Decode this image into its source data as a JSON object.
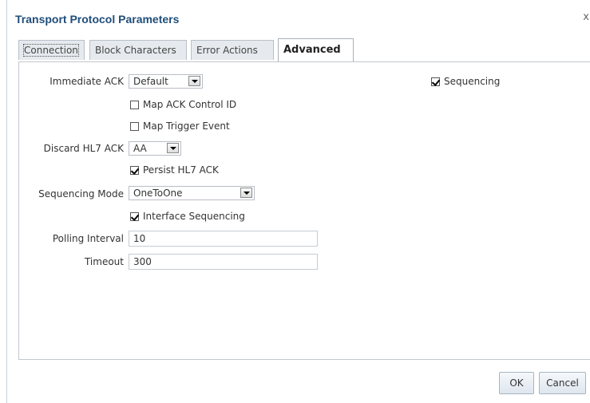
{
  "dialog": {
    "title": "Transport Protocol Parameters",
    "close_symbol": "x"
  },
  "tabs": [
    {
      "label": "Connection"
    },
    {
      "label": "Block Characters"
    },
    {
      "label": "Error Actions"
    },
    {
      "label": "Advanced"
    }
  ],
  "form": {
    "immediate_ack": {
      "label": "Immediate ACK",
      "value": "Default"
    },
    "map_ack_control_id": {
      "label": "Map ACK Control ID",
      "checked": false
    },
    "map_trigger_event": {
      "label": "Map Trigger Event",
      "checked": false
    },
    "discard_hl7_ack": {
      "label": "Discard HL7 ACK",
      "value": "AA"
    },
    "persist_hl7_ack": {
      "label": "Persist HL7 ACK",
      "checked": true
    },
    "sequencing_mode": {
      "label": "Sequencing Mode",
      "value": "OneToOne"
    },
    "interface_sequencing": {
      "label": "Interface Sequencing",
      "checked": true
    },
    "polling_interval": {
      "label": "Polling Interval",
      "value": "10"
    },
    "timeout": {
      "label": "Timeout",
      "value": "300"
    },
    "sequencing": {
      "label": "Sequencing",
      "checked": true
    }
  },
  "buttons": {
    "ok": "OK",
    "cancel": "Cancel"
  }
}
